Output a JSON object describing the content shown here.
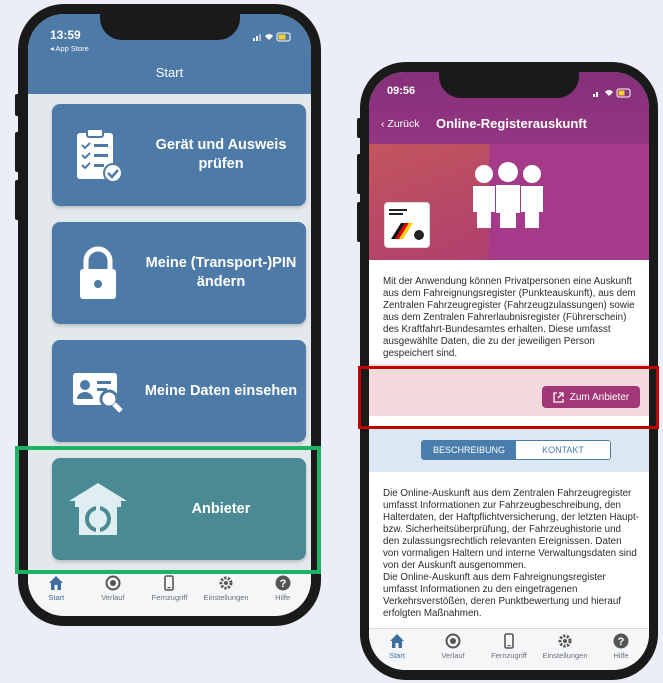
{
  "phone1": {
    "status": {
      "time": "13:59",
      "back_app": "◂ App Store"
    },
    "header": {
      "title": "Start"
    },
    "tiles": [
      {
        "label": "Gerät und Ausweis prüfen",
        "icon": "clipboard-check-icon"
      },
      {
        "label": "Meine (Transport-)PIN ändern",
        "icon": "lock-icon"
      },
      {
        "label": "Meine Daten einsehen",
        "icon": "id-card-search-icon"
      },
      {
        "label": "Anbieter",
        "icon": "provider-house-icon"
      }
    ],
    "tabbar": [
      {
        "label": "Start",
        "icon": "home-icon",
        "active": true
      },
      {
        "label": "Verlauf",
        "icon": "history-icon",
        "active": false
      },
      {
        "label": "Fernzugriff",
        "icon": "phone-icon",
        "active": false
      },
      {
        "label": "Einstellungen",
        "icon": "gear-icon",
        "active": false
      },
      {
        "label": "Hilfe",
        "icon": "help-icon",
        "active": false
      }
    ]
  },
  "phone2": {
    "status": {
      "time": "09:56"
    },
    "nav": {
      "back": "Zurück",
      "title": "Online-Registerauskunft"
    },
    "description": "Mit der Anwendung können Privatpersonen eine Auskunft aus dem Fahreignungsregister (Punkteauskunft), aus dem Zentralen Fahrzeugregister (Fahrzeugzulassungen) sowie aus dem Zentralen Fahrerlaubnisregister (Führerschein) des Kraftfahrt-Bundesamtes erhalten. Diese umfasst ausgewählte Daten, die zu der jeweiligen Person gespeichert sind.",
    "provider_button": "Zum Anbieter",
    "segments": [
      "BESCHREIBUNG",
      "KONTAKT"
    ],
    "body": "Die Online-Auskunft aus dem Zentralen Fahrzeugregister umfasst Informationen zur Fahrzeugbeschreibung, den Halterdaten, der Haftpflichtversicherung, der letzten Haupt- bzw. Sicherheitsüberprüfung, der Fahrzeughistorie und den zulassungsrechtlich relevanten Ereignissen. Daten von vormaligen Haltern und interne Verwaltungsdaten sind von der Auskunft ausgenommen.\nDie Online-Auskunft aus dem Fahreignungsregister umfasst Informationen zu den eingetragenen Verkehrsverstößen, deren Punktbewertung und hierauf erfolgten Maßnahmen.",
    "tabbar": [
      {
        "label": "Start",
        "icon": "home-icon",
        "active": true
      },
      {
        "label": "Verlauf",
        "icon": "history-icon",
        "active": false
      },
      {
        "label": "Fernzugriff",
        "icon": "phone-icon",
        "active": false
      },
      {
        "label": "Einstellungen",
        "icon": "gear-icon",
        "active": false
      },
      {
        "label": "Hilfe",
        "icon": "help-icon",
        "active": false
      }
    ]
  },
  "colors": {
    "tile_blue": "#4d7aa6",
    "tile_teal": "#4a8a95",
    "header_purple": "#a63a8a",
    "highlight_green": "#1db264",
    "highlight_red": "#c10000"
  }
}
